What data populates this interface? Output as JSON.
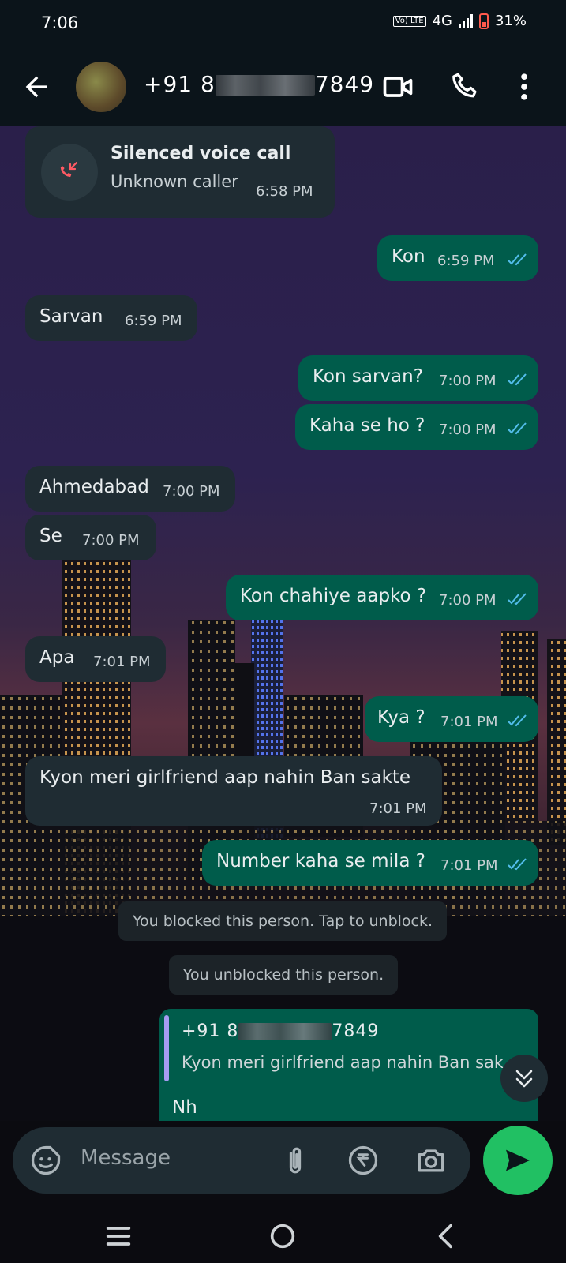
{
  "status": {
    "time": "7:06",
    "volte": "Vo) LTE",
    "network": "4G",
    "battery": "31%"
  },
  "header": {
    "title_prefix": "+91 8",
    "title_suffix": "7849"
  },
  "call": {
    "title": "Silenced voice call",
    "subtitle": "Unknown caller",
    "time": "6:58 PM"
  },
  "messages": [
    {
      "dir": "out",
      "text": "Kon",
      "time": "6:59 PM"
    },
    {
      "dir": "in",
      "text": "Sarvan",
      "time": "6:59 PM"
    },
    {
      "dir": "out",
      "text": "Kon sarvan?",
      "time": "7:00 PM"
    },
    {
      "dir": "out",
      "text": "Kaha se ho ?",
      "time": "7:00 PM"
    },
    {
      "dir": "in",
      "text": "Ahmedabad",
      "time": "7:00 PM"
    },
    {
      "dir": "in",
      "text": "Se",
      "time": "7:00 PM"
    },
    {
      "dir": "out",
      "text": "Kon chahiye aapko ?",
      "time": "7:00 PM"
    },
    {
      "dir": "in",
      "text": "Apa",
      "time": "7:01 PM"
    },
    {
      "dir": "out",
      "text": "Kya ?",
      "time": "7:01 PM"
    },
    {
      "dir": "in",
      "text": "Kyon meri girlfriend aap nahin Ban sakte",
      "time": "7:01 PM"
    },
    {
      "dir": "out",
      "text": "Number kaha se mila ?",
      "time": "7:01 PM"
    }
  ],
  "system": {
    "blocked": "You blocked this person. Tap to unblock.",
    "unblocked": "You unblocked this person."
  },
  "reply": {
    "quote_prefix": "+91 8",
    "quote_suffix": "7849",
    "quote_text": "Kyon meri girlfriend aap nahin Ban sak",
    "partial_text": "Nh"
  },
  "input": {
    "placeholder": "Message"
  },
  "colors": {
    "outgoing": "#005c4b",
    "incoming": "#1f2c33",
    "accent": "#21c063",
    "read_ticks": "#53bdeb"
  }
}
